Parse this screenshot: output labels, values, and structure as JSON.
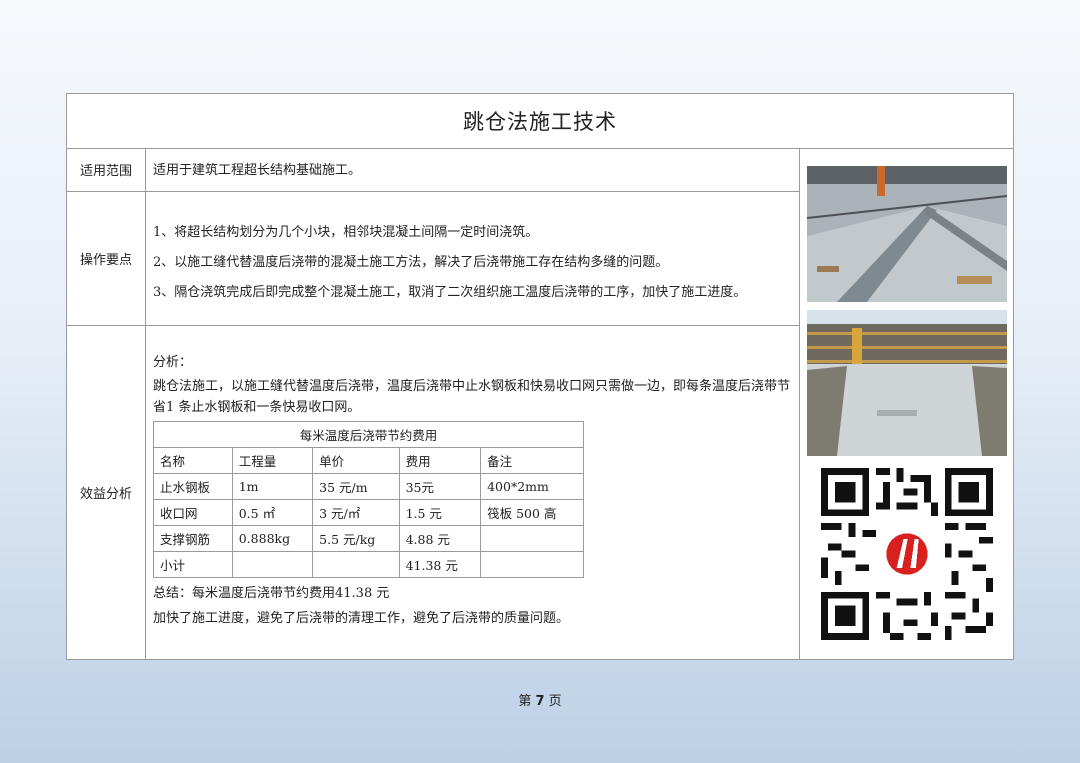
{
  "title": "跳仓法施工技术",
  "rows": {
    "scope_label": "适用范围",
    "scope_text": "适用于建筑工程超长结构基础施工。",
    "points_label": "操作要点",
    "points": [
      "1、将超长结构划分为几个小块，相邻块混凝土间隔一定时间浇筑。",
      "2、以施工缝代替温度后浇带的混凝土施工方法，解决了后浇带施工存在结构多缝的问题。",
      "3、隔仓浇筑完成后即完成整个混凝土施工，取消了二次组织施工温度后浇带的工序，加快了施工进度。"
    ],
    "benefit_label": "效益分析",
    "analysis_heading": "分析：",
    "analysis_text": "跳仓法施工，以施工缝代替温度后浇带，温度后浇带中止水钢板和快易收口网只需做一边，即每条温度后浇带节省1 条止水钢板和一条快易收口网。",
    "summary": "总结：每米温度后浇带节约费用41.38 元",
    "conclusion": "加快了施工进度，避免了后浇带的清理工作，避免了后浇带的质量问题。"
  },
  "cost_table": {
    "caption": "每米温度后浇带节约费用",
    "headers": [
      "名称",
      "工程量",
      "单价",
      "费用",
      "备注"
    ],
    "rows": [
      [
        "止水钢板",
        "1m",
        "35 元/m",
        "35元",
        "400*2mm"
      ],
      [
        "收口网",
        "0.5 ㎡",
        "3 元/㎡",
        "1.5 元",
        "筏板 500 高"
      ],
      [
        "支撑钢筋",
        "0.888kg",
        "5.5 元/kg",
        "4.88 元",
        ""
      ],
      [
        "小计",
        "",
        "",
        "41.38 元",
        ""
      ]
    ]
  },
  "footer": {
    "prefix": "第",
    "page": "7",
    "suffix": "页"
  },
  "colors": {
    "border": "#9a9a9a",
    "qr_logo": "#d8201f"
  }
}
